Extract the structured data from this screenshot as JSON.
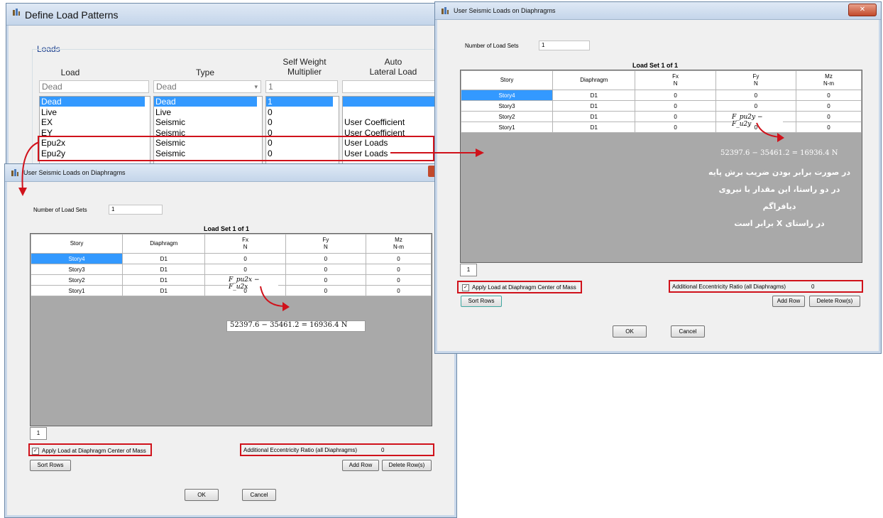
{
  "define_window": {
    "title": "Define Load Patterns",
    "group_label": "Loads",
    "headers": {
      "load": "Load",
      "type": "Type",
      "self_weight": "Self Weight\nMultiplier",
      "auto_lateral": "Auto\nLateral Load"
    },
    "input_row": {
      "load": "Dead",
      "type": "Dead",
      "multiplier": "1"
    },
    "rows": [
      {
        "load": "Dead",
        "type": "Dead",
        "multiplier": "1",
        "auto": ""
      },
      {
        "load": "Live",
        "type": "Live",
        "multiplier": "0",
        "auto": ""
      },
      {
        "load": "EX",
        "type": "Seismic",
        "multiplier": "0",
        "auto": "User Coefficient"
      },
      {
        "load": "EY",
        "type": "Seismic",
        "multiplier": "0",
        "auto": "User Coefficient"
      },
      {
        "load": "Epu2x",
        "type": "Seismic",
        "multiplier": "0",
        "auto": "User Loads"
      },
      {
        "load": "Epu2y",
        "type": "Seismic",
        "multiplier": "0",
        "auto": "User Loads"
      }
    ]
  },
  "seismic_x": {
    "title": "User Seismic Loads on Diaphragms",
    "num_sets_label": "Number of Load Sets",
    "num_sets_value": "1",
    "load_set_label": "Load Set 1 of 1",
    "columns": [
      {
        "name": "Story",
        "unit": ""
      },
      {
        "name": "Diaphragm",
        "unit": ""
      },
      {
        "name": "Fx",
        "unit": "N"
      },
      {
        "name": "Fy",
        "unit": "N"
      },
      {
        "name": "Mz",
        "unit": "N-m"
      }
    ],
    "rows": [
      [
        "Story4",
        "D1",
        "0",
        "0",
        "0"
      ],
      [
        "Story3",
        "D1",
        "0",
        "0",
        "0"
      ],
      [
        "Story2",
        "D1",
        "",
        "0",
        "0"
      ],
      [
        "Story1",
        "D1",
        "0",
        "0",
        "0"
      ]
    ],
    "formula": "F_pu2x − F_u2x",
    "equation": "52397.6 − 35461.2 = 16936.4 N",
    "tab": "1",
    "apply_label": "Apply Load at Diaphragm Center of Mass",
    "ecc_label": "Additional Eccentricity Ratio (all Diaphragms)",
    "ecc_value": "0",
    "sort_rows": "Sort Rows",
    "add_row": "Add Row",
    "delete_rows": "Delete Row(s)",
    "ok": "OK",
    "cancel": "Cancel"
  },
  "seismic_y": {
    "title": "User Seismic Loads on Diaphragms",
    "num_sets_label": "Number of Load Sets",
    "num_sets_value": "1",
    "load_set_label": "Load Set 1 of 1",
    "columns": [
      {
        "name": "Story",
        "unit": ""
      },
      {
        "name": "Diaphragm",
        "unit": ""
      },
      {
        "name": "Fx",
        "unit": "N"
      },
      {
        "name": "Fy",
        "unit": "N"
      },
      {
        "name": "Mz",
        "unit": "N-m"
      }
    ],
    "rows": [
      [
        "Story4",
        "D1",
        "0",
        "0",
        "0"
      ],
      [
        "Story3",
        "D1",
        "0",
        "0",
        "0"
      ],
      [
        "Story2",
        "D1",
        "0",
        "",
        "0"
      ],
      [
        "Story1",
        "D1",
        "0",
        "0",
        "0"
      ]
    ],
    "formula": "F_pu2y − F_u2y",
    "equation": "52397.6 − 35461.2 = 16936.4 N",
    "note_lines": [
      "در صورت برابر بودن ضریب برش پایه",
      "در دو راستا، این مقدار با نیروی دیافراگم",
      "در راستای X برابر است"
    ],
    "tab": "1",
    "apply_label": "Apply Load at Diaphragm Center of Mass",
    "ecc_label": "Additional Eccentricity Ratio (all Diaphragms)",
    "ecc_value": "0",
    "sort_rows": "Sort Rows",
    "add_row": "Add Row",
    "delete_rows": "Delete Row(s)",
    "ok": "OK",
    "cancel": "Cancel"
  },
  "colors": {
    "accent": "#3399ff",
    "annotation": "#d0121b"
  }
}
